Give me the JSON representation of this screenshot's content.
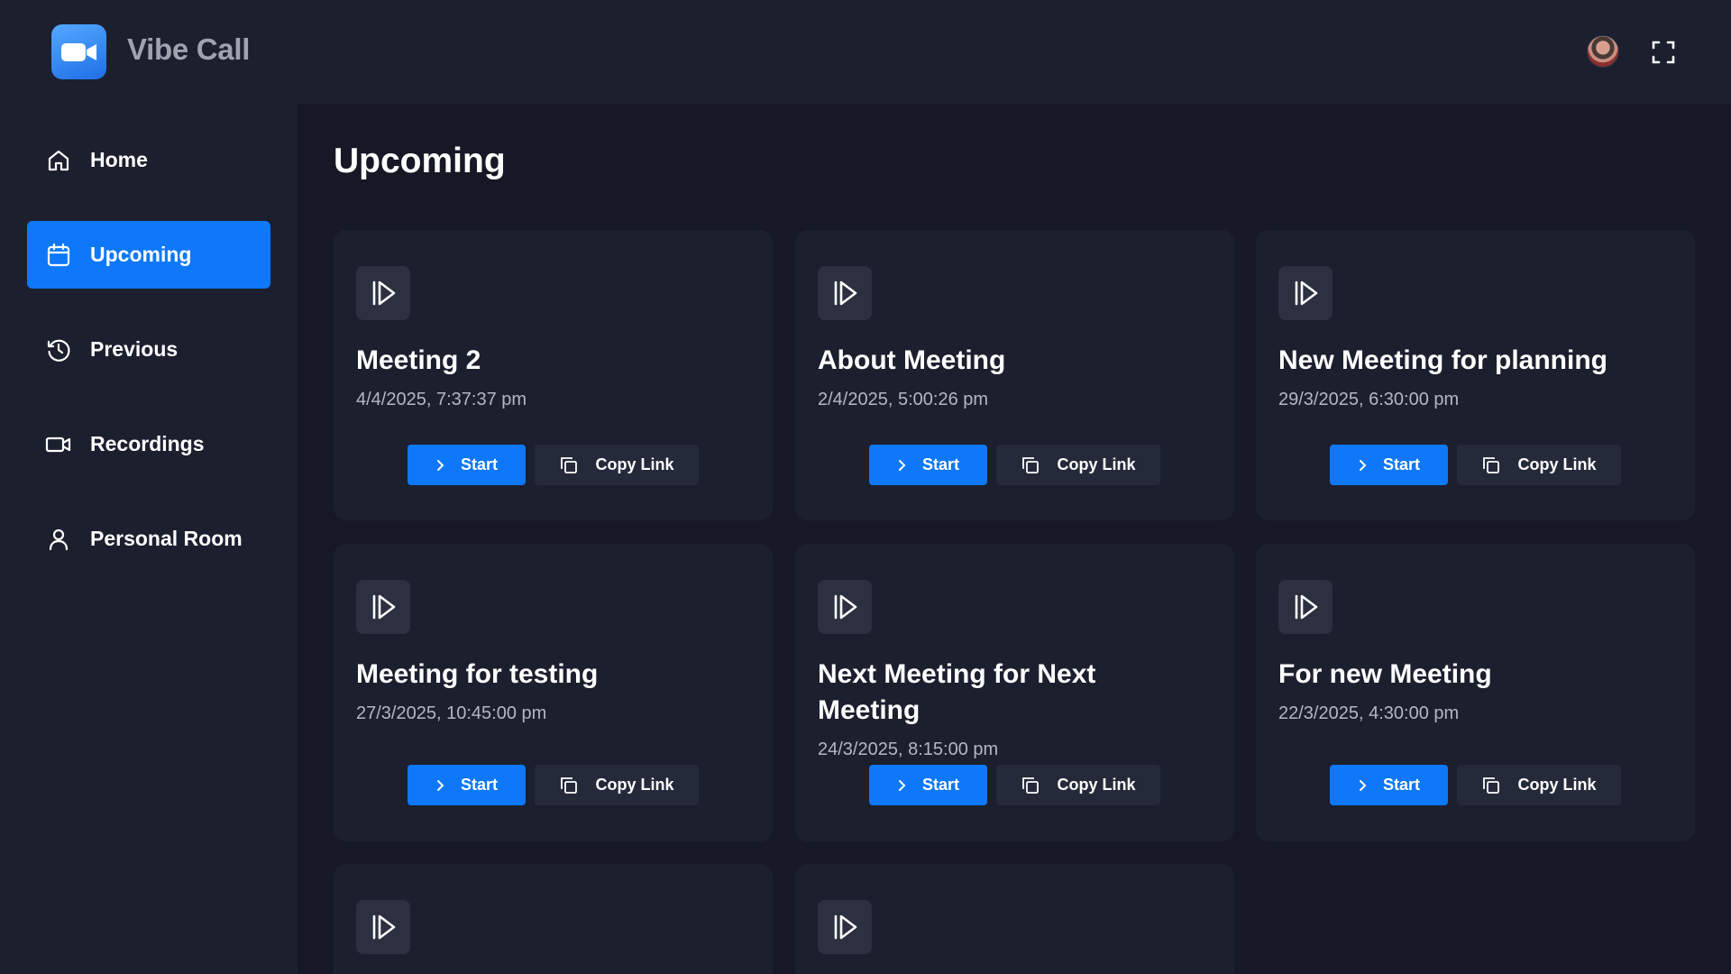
{
  "app": {
    "name": "Vibe Call",
    "logo_icon": "video-camera-icon"
  },
  "header": {
    "avatar_icon": "user-avatar",
    "fullscreen_icon": "fullscreen-icon"
  },
  "sidebar": {
    "items": [
      {
        "label": "Home",
        "icon": "home-icon",
        "active": false
      },
      {
        "label": "Upcoming",
        "icon": "calendar-icon",
        "active": true
      },
      {
        "label": "Previous",
        "icon": "history-icon",
        "active": false
      },
      {
        "label": "Recordings",
        "icon": "video-icon",
        "active": false
      },
      {
        "label": "Personal Room",
        "icon": "user-icon",
        "active": false
      }
    ]
  },
  "main": {
    "title": "Upcoming",
    "meetings": [
      {
        "title": "Meeting 2",
        "date": "4/4/2025, 7:37:37 pm"
      },
      {
        "title": "About Meeting",
        "date": "2/4/2025, 5:00:26 pm"
      },
      {
        "title": "New Meeting for planning",
        "date": "29/3/2025, 6:30:00 pm"
      },
      {
        "title": "Meeting for testing",
        "date": "27/3/2025, 10:45:00 pm"
      },
      {
        "title": "Next Meeting for Next Meeting",
        "date": "24/3/2025, 8:15:00 pm"
      },
      {
        "title": "For new Meeting",
        "date": "22/3/2025, 4:30:00 pm"
      }
    ],
    "start_label": "Start",
    "copy_label": "Copy Link"
  },
  "colors": {
    "background": "#161925",
    "panel": "#1c1f2e",
    "accent": "#0e78f9",
    "icon_box": "#2c3040",
    "secondary_button": "#252a3a"
  }
}
